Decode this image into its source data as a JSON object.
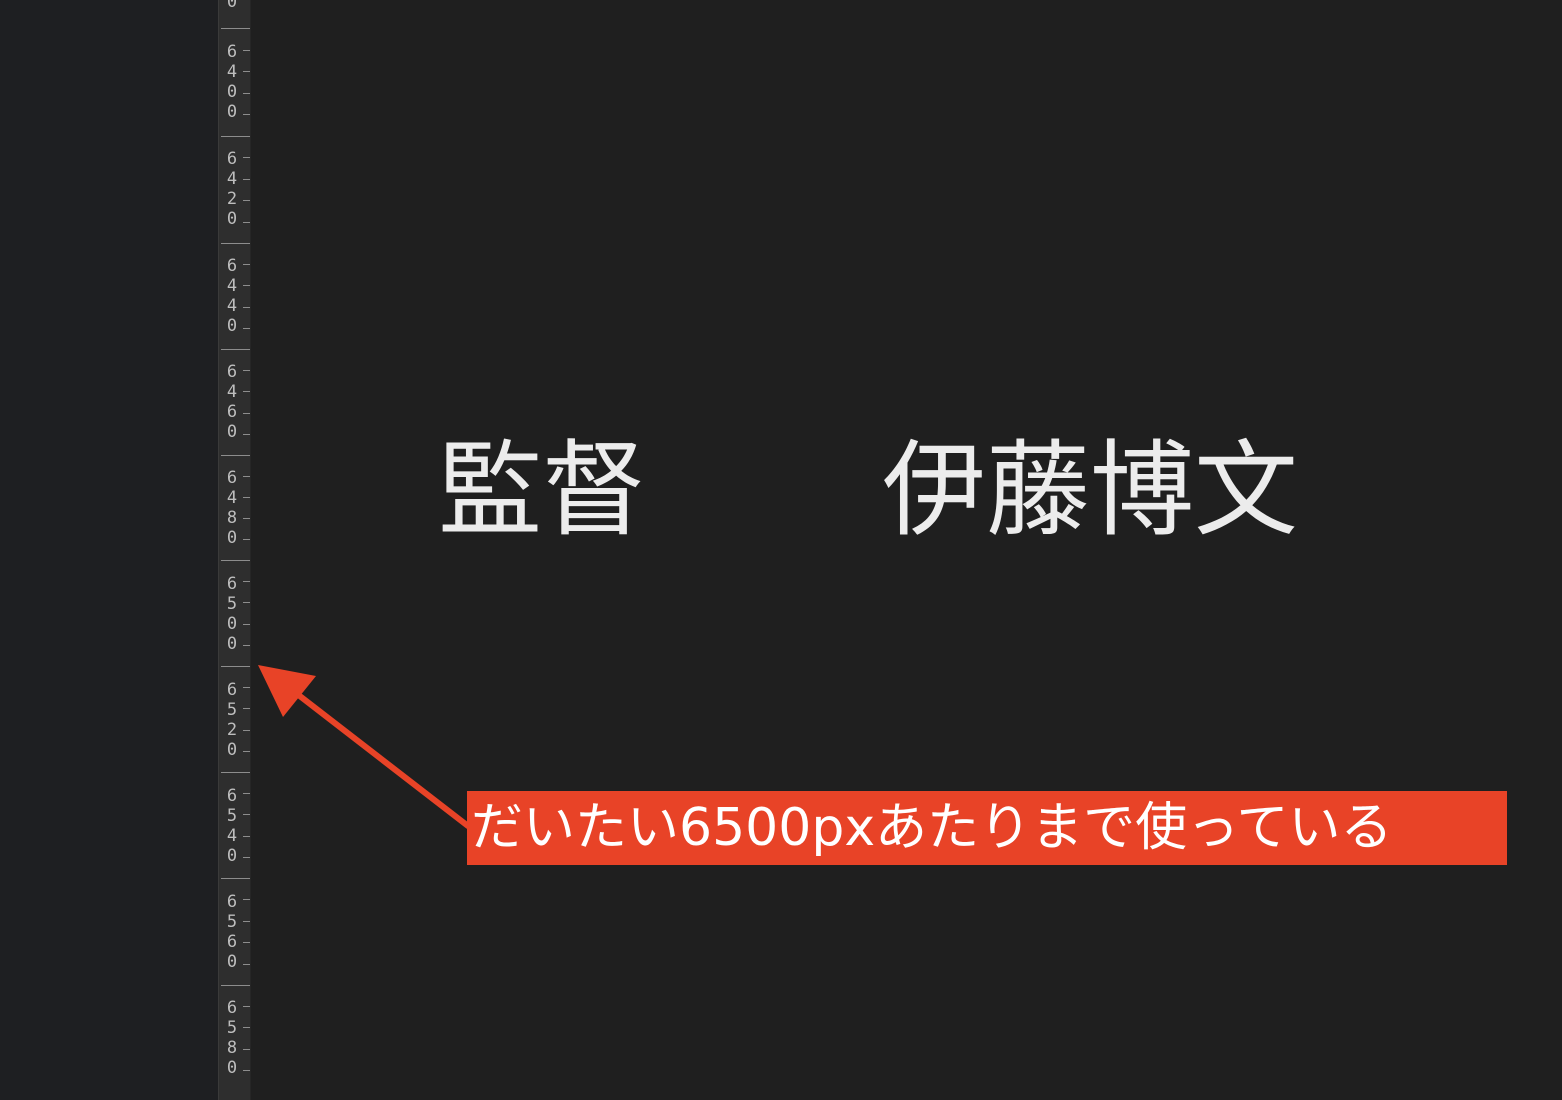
{
  "ruler": {
    "labels": [
      "6400",
      "6420",
      "6440",
      "6460",
      "6480",
      "6500",
      "6520",
      "6540",
      "6560",
      "6580"
    ]
  },
  "canvas": {
    "credit_role": "監督",
    "credit_name": "伊藤博文"
  },
  "annotation": {
    "text": "だいたい6500pxあたりまで使っている",
    "color": "#e84327",
    "text_color": "#ffffff"
  },
  "colors": {
    "background": "#1f1f1f",
    "ruler_background": "#2e2e2e",
    "text": "#ececec"
  }
}
